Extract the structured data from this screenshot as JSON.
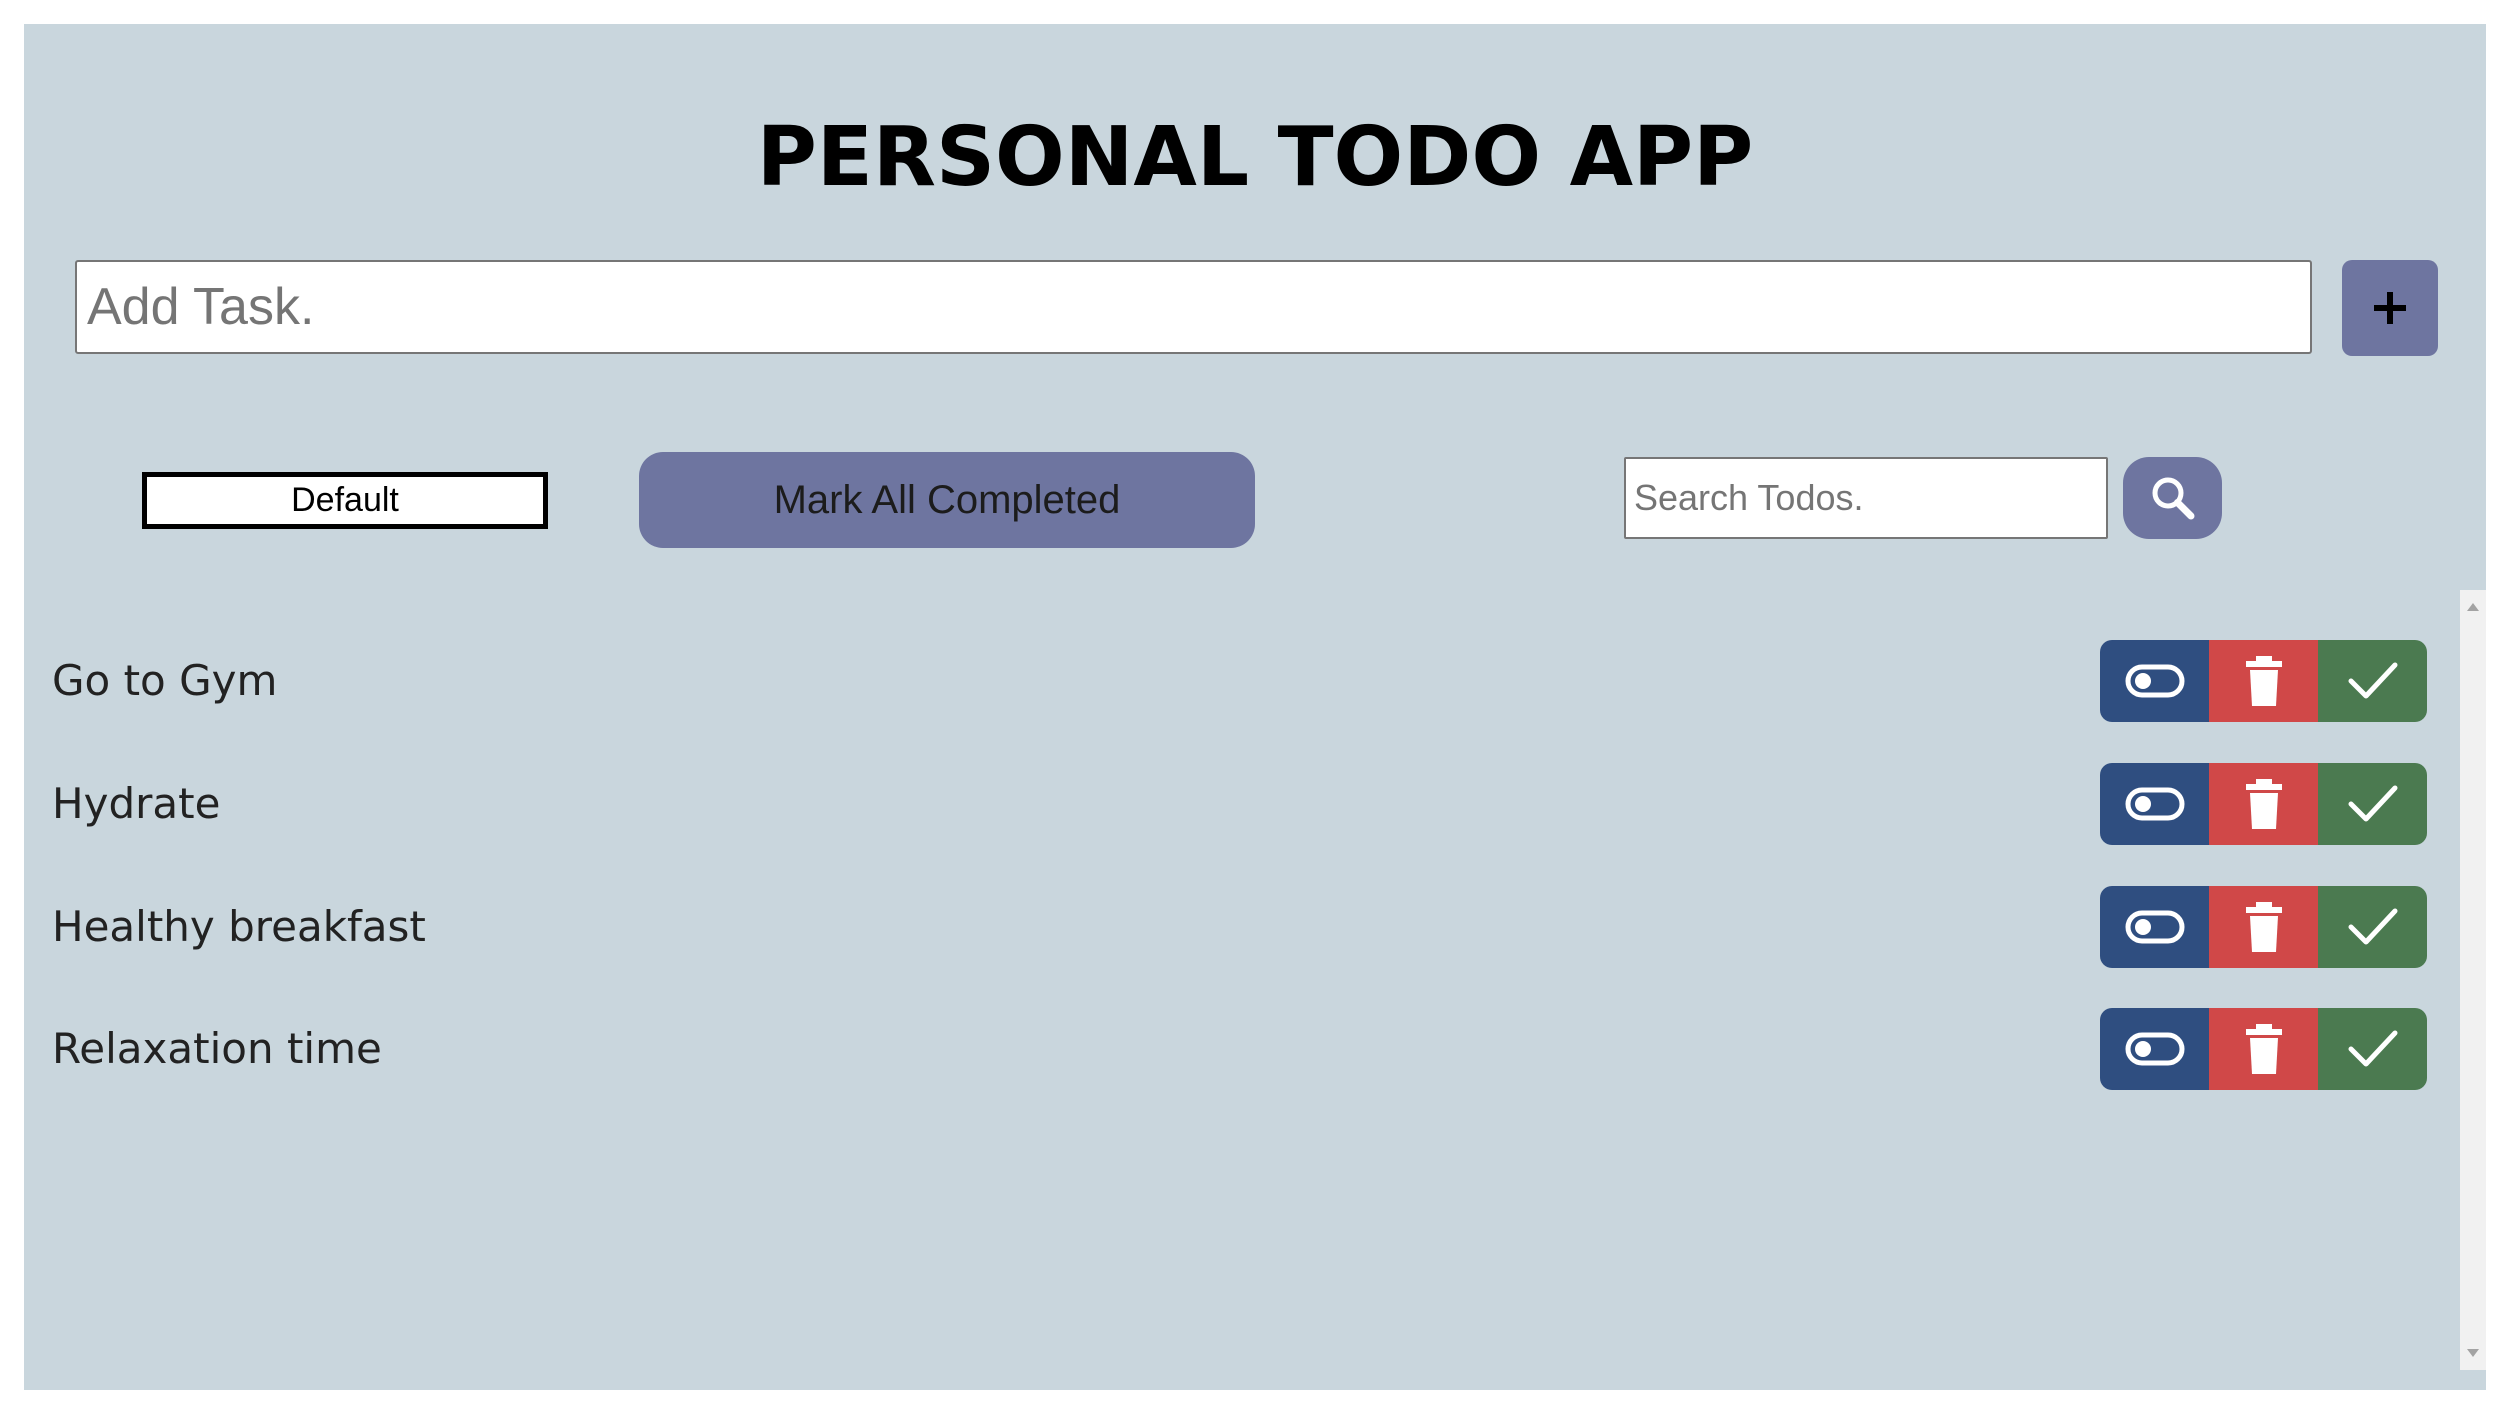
{
  "app": {
    "title": "PERSONAL TODO APP"
  },
  "add_task": {
    "placeholder": "Add Task.",
    "button_icon": "plus-icon"
  },
  "controls": {
    "filter_selected": "Default",
    "mark_all_label": "Mark All Completed",
    "search_placeholder": "Search Todos.",
    "search_icon": "search-icon"
  },
  "todos": [
    {
      "text": "Go to Gym"
    },
    {
      "text": "Hydrate"
    },
    {
      "text": "Healthy breakfast"
    },
    {
      "text": "Relaxation time"
    }
  ],
  "row_actions": {
    "toggle_icon": "toggle-icon",
    "delete_icon": "trash-icon",
    "complete_icon": "check-icon"
  },
  "colors": {
    "background": "#c9d6dd",
    "primary_button": "#6e75a0",
    "toggle_button": "#2f4e80",
    "delete_button": "#d04848",
    "complete_button": "#4b7a50"
  }
}
